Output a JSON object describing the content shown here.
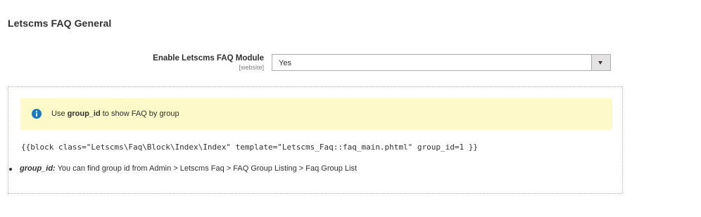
{
  "section": {
    "title": "Letscms FAQ General"
  },
  "field": {
    "label": "Enable Letscms FAQ Module",
    "scope": "[website]",
    "value": "Yes"
  },
  "comment": {
    "notice": {
      "icon": "info-icon",
      "prefix": "Use ",
      "keyword": "group_id",
      "suffix": " to show FAQ by group"
    },
    "code": "{{block class=\"Letscms\\Faq\\Block\\Index\\Index\" template=\"Letscms_Faq::faq_main.phtml\" group_id=1 }}",
    "help_items": [
      {
        "term": "group_id:",
        "text": " You can find group id from Admin > Letscms Faq > FAQ Group Listing > Faq Group List"
      }
    ]
  },
  "colors": {
    "notice_background": "#fdf9c8",
    "info_icon": "#1979c3",
    "text": "#303030"
  }
}
